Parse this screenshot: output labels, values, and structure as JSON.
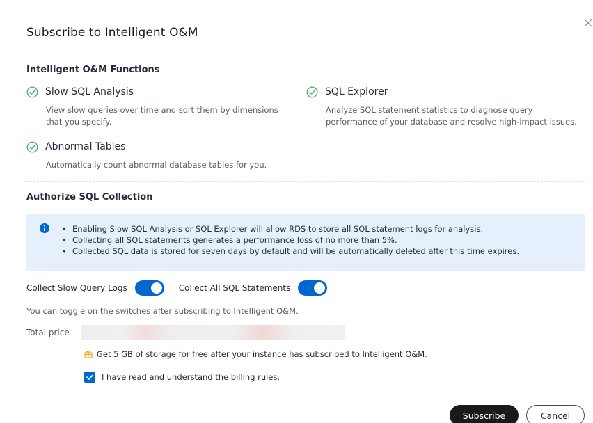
{
  "dialog": {
    "title": "Subscribe to Intelligent O&M",
    "close_icon": "close-icon"
  },
  "functions": {
    "heading": "Intelligent O&M Functions",
    "items": [
      {
        "name": "Slow SQL Analysis",
        "desc_lines": [
          "View slow queries over time and sort them by dimensions",
          "that you specify."
        ],
        "icon": "check-circle-icon"
      },
      {
        "name": "SQL Explorer",
        "desc_lines": [
          "Analyze SQL statement statistics to diagnose query",
          "performance of your database and resolve high-impact issues."
        ],
        "icon": "check-circle-icon"
      },
      {
        "name": "Abnormal Tables",
        "desc_lines": [
          "Automatically count abnormal database tables for you."
        ],
        "icon": "check-circle-icon"
      }
    ]
  },
  "authorize": {
    "heading": "Authorize SQL Collection",
    "notice_icon": "info-icon",
    "notice_items": [
      "Enabling Slow SQL Analysis or SQL Explorer will allow RDS to store all SQL statement logs for analysis.",
      "Collecting all SQL statements generates a performance loss of no more than 5%.",
      "Collected SQL data is stored for seven days by default and will be automatically deleted after this time expires."
    ],
    "switch_slow_label": "Collect Slow Query Logs",
    "switch_slow_on": true,
    "switch_all_label": "Collect All SQL Statements",
    "switch_all_on": true,
    "hint": "You can toggle on the switches after subscribing to Intelligent O&M."
  },
  "pricing": {
    "label": "Total price",
    "gift_icon": "gift-icon",
    "gift_text": "Get 5 GB of storage for free after your instance has subscribed to Intelligent O&M.",
    "agree_text": "I have read and understand the billing rules.",
    "agree_checked": true
  },
  "footer": {
    "subscribe_label": "Subscribe",
    "cancel_label": "Cancel"
  },
  "colors": {
    "accent": "#0067d1",
    "check_green": "#4fb26d",
    "notice_bg": "#e6f0fc",
    "primary_button": "#191919"
  }
}
